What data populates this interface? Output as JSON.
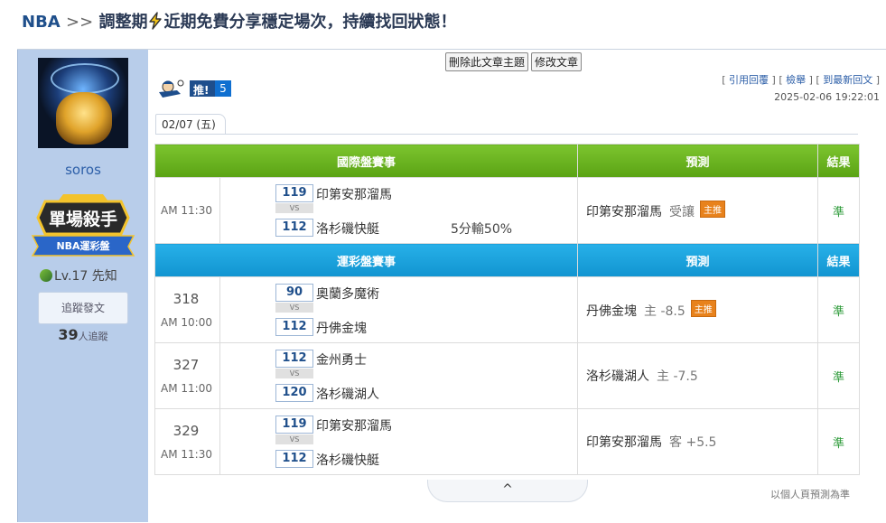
{
  "title": {
    "league": "NBA",
    "sep": ">>",
    "text_pre": "調整期",
    "text_post": "近期免費分享穩定場次，持續找回狀態！"
  },
  "user": {
    "name": "soros",
    "badge_main": "單場殺手",
    "badge_sub": "NBA運彩盤",
    "level": "Lv.17 先知",
    "follow_label": "追蹤發文",
    "followers_count": "39",
    "followers_suffix": "人追蹤"
  },
  "actions": {
    "delete": "刪除此文章主題",
    "edit": "修改文章"
  },
  "push": {
    "label": "推!",
    "count": "5"
  },
  "links": {
    "quote": "引用回覆",
    "report": "檢舉",
    "latest": "到最新回文",
    "datetime": "2025-02-06 19:22:01"
  },
  "tab": "02/07 (五)",
  "intl": {
    "header": {
      "event": "國際盤賽事",
      "pred": "預測",
      "result": "結果"
    },
    "games": [
      {
        "time": "AM 11:30",
        "s1": "119",
        "s2": "112",
        "t1": "印第安那溜馬",
        "t2": "洛杉磯快艇",
        "note": "5分輸50%",
        "pick": "印第安那溜馬",
        "pick_sub": "受讓",
        "main": "主推",
        "result": "準"
      }
    ]
  },
  "sport": {
    "header": {
      "event": "運彩盤賽事",
      "pred": "預測",
      "result": "結果"
    },
    "games": [
      {
        "no": "318",
        "time": "AM 10:00",
        "s1": "90",
        "s2": "112",
        "t1": "奧蘭多魔術",
        "t2": "丹佛金塊",
        "pick": "丹佛金塊",
        "pick_sub": "主 -8.5",
        "main": "主推",
        "result": "準"
      },
      {
        "no": "327",
        "time": "AM 11:00",
        "s1": "112",
        "s2": "120",
        "t1": "金州勇士",
        "t2": "洛杉磯湖人",
        "pick": "洛杉磯湖人",
        "pick_sub": "主 -7.5",
        "result": "準"
      },
      {
        "no": "329",
        "time": "AM 11:30",
        "s1": "119",
        "s2": "112",
        "t1": "印第安那溜馬",
        "t2": "洛杉磯快艇",
        "pick": "印第安那溜馬",
        "pick_sub": "客 +5.5",
        "result": "準"
      }
    ]
  },
  "vs": "VS",
  "collapse_icon": "^",
  "footnote": "以個人頁預測為準"
}
